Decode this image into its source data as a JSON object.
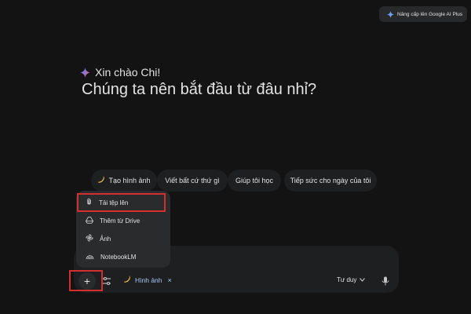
{
  "header": {
    "upgrade_label": "Nâng cấp lên Google AI Plus",
    "upgrade_icon": "gemini-spark-icon"
  },
  "greeting": {
    "hello": "Xin chào Chi!",
    "headline": "Chúng ta nên bắt đầu từ đâu nhỉ?"
  },
  "suggestions": [
    {
      "label": "Tạo hình ảnh",
      "icon": "banana-icon"
    },
    {
      "label": "Viết bất cứ thứ gì"
    },
    {
      "label": "Giúp tôi học"
    },
    {
      "label": "Tiếp sức cho ngày của tôi"
    }
  ],
  "upload_menu": {
    "items": [
      {
        "label": "Tải tệp lên",
        "icon": "paperclip-icon"
      },
      {
        "label": "Thêm từ Drive",
        "icon": "drive-icon"
      },
      {
        "label": "Ảnh",
        "icon": "photos-icon"
      },
      {
        "label": "NotebookLM",
        "icon": "notebooklm-icon"
      }
    ]
  },
  "composer": {
    "plus_label": "+",
    "tools_icon": "tools-sliders-icon",
    "active_tool": "Hình ảnh",
    "active_tool_close": "×",
    "mode": "Tư duy",
    "mic_icon": "microphone-icon"
  },
  "colors": {
    "background": "#131314",
    "surface": "#1e1f20",
    "highlight": "#d32f2f",
    "accent_blue": "#a8c7fa"
  }
}
